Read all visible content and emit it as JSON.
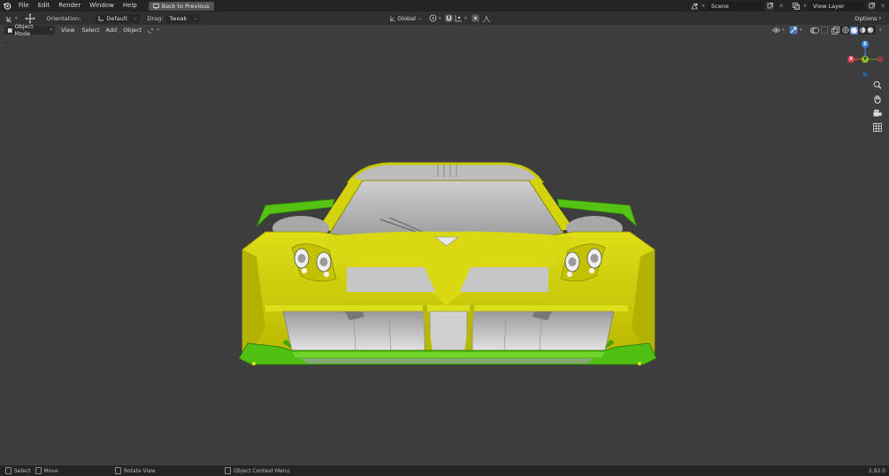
{
  "menu": {
    "items": [
      "File",
      "Edit",
      "Render",
      "Window",
      "Help"
    ],
    "back_button": "Back to Previous"
  },
  "topright": {
    "scene": "Scene",
    "view_layer": "View Layer"
  },
  "toolsettings": {
    "orientation_label": "Orientation:",
    "orientation_value": "Default",
    "drag_label": "Drag:",
    "drag_value": "Tweak",
    "transform_orientation": "Global",
    "options": "Options"
  },
  "viewport_header": {
    "mode": "Object Mode",
    "view": "View",
    "select": "Select",
    "add": "Add",
    "object": "Object"
  },
  "gizmo": {
    "z": "Z",
    "y": "Y",
    "x": "X"
  },
  "statusbar": {
    "select": "Select",
    "move": "Move",
    "rotate": "Rotate View",
    "context": "Object Context Menu",
    "version": "2.92.0"
  },
  "colors": {
    "body_yellow": "#d2d20a",
    "wing_green": "#4fbf12",
    "glass_gray": "#b4b4b4",
    "gizmo_x": "#e23b4e",
    "gizmo_y": "#8bc621",
    "gizmo_z": "#3f83e3"
  }
}
